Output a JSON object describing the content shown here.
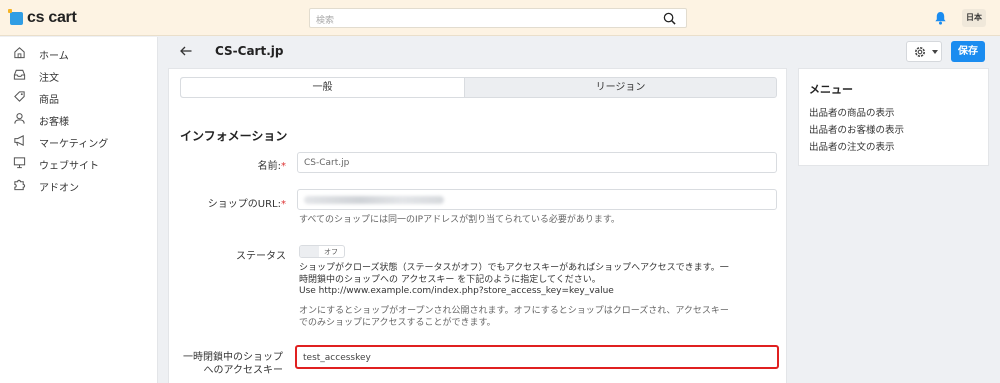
{
  "header": {
    "logo_text": "cs cart",
    "search_placeholder": "検索",
    "language": "日本"
  },
  "sidebar": {
    "items": [
      {
        "label": "ホーム",
        "icon": "home-icon"
      },
      {
        "label": "注文",
        "icon": "inbox-icon"
      },
      {
        "label": "商品",
        "icon": "tag-icon"
      },
      {
        "label": "お客様",
        "icon": "user-icon"
      },
      {
        "label": "マーケティング",
        "icon": "megaphone-icon"
      },
      {
        "label": "ウェブサイト",
        "icon": "monitor-icon"
      },
      {
        "label": "アドオン",
        "icon": "puzzle-icon"
      }
    ]
  },
  "page": {
    "title": "CS-Cart.jp",
    "save_label": "保存"
  },
  "tabs": [
    "一般",
    "リージョン"
  ],
  "form": {
    "section_title": "インフォメーション",
    "name_label": "名前:",
    "name_value": "CS-Cart.jp",
    "url_label": "ショップのURL:",
    "url_help": "すべてのショップには同一のIPアドレスが割り当てられている必要があります。",
    "status_label": "ステータス",
    "toggle_state": "オフ",
    "status_desc_1": "ショップがクローズ状態（ステータスがオフ）でもアクセスキーがあればショップへアクセスできます。一",
    "status_desc_2": "時閉鎖中のショップへの アクセスキー を下記のように指定してください。",
    "status_desc_3": "Use http://www.example.com/index.php?store_access_key=key_value",
    "status_help_1": "オンにするとショップがオープンされ公開されます。オフにするとショップはクローズされ、アクセスキー",
    "status_help_2": "でのみショップにアクセスすることができます。",
    "access_key_label_1": "一時閉鎖中のショップ",
    "access_key_label_2": "へのアクセスキー",
    "access_key_value": "test_accesskey",
    "required_mark": "*"
  },
  "right_menu": {
    "title": "メニュー",
    "links": [
      "出品者の商品の表示",
      "出品者のお客様の表示",
      "出品者の注文の表示"
    ]
  },
  "colors": {
    "header_bg": "#fdf3e3",
    "accent": "#1a8cf0",
    "highlight": "#e02020"
  }
}
